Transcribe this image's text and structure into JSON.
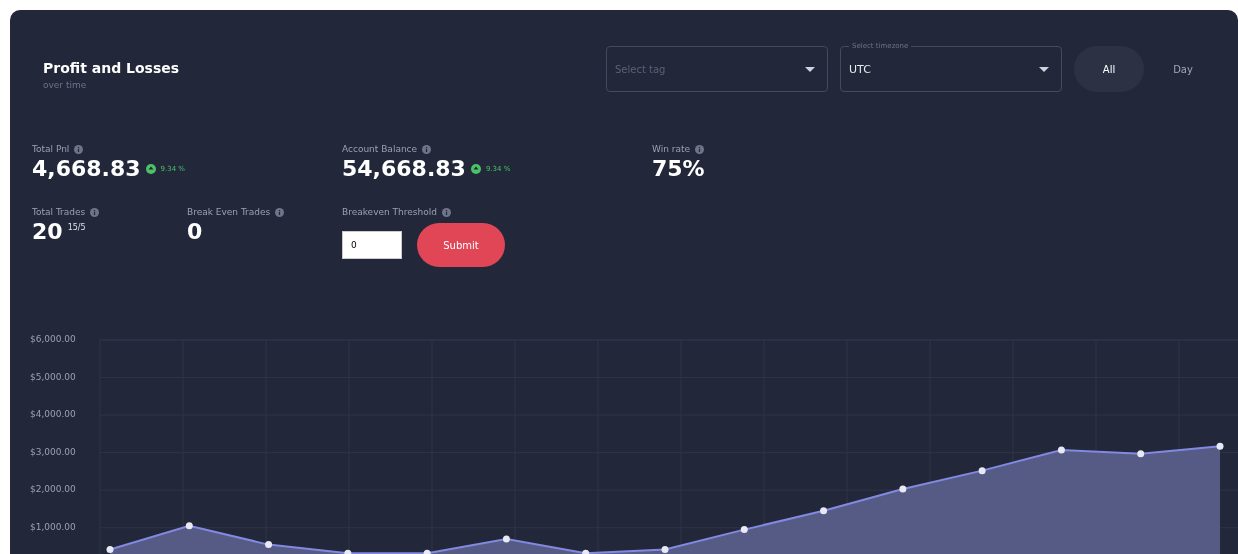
{
  "header": {
    "title": "Profit and Losses",
    "subtitle": "over time"
  },
  "tag_select": {
    "placeholder": "Select tag"
  },
  "timezone_select": {
    "label": "Select timezone",
    "value": "UTC"
  },
  "range_tabs": [
    {
      "label": "All",
      "selected": true
    },
    {
      "label": "Day",
      "selected": false
    }
  ],
  "stats": [
    {
      "label": "Total Pnl",
      "value": "4,668.83",
      "change": "9.34 %"
    },
    {
      "label": "Account Balance",
      "value": "54,668.83",
      "change": "9.34 %"
    },
    {
      "label": "Win rate",
      "value": "75%"
    }
  ],
  "trades": [
    {
      "label": "Total Trades",
      "value": "20",
      "sub": "15/5"
    },
    {
      "label": "Break Even Trades",
      "value": "0"
    }
  ],
  "threshold": {
    "label": "Breakeven Threshold",
    "value": "0",
    "button": "Submit"
  },
  "chart": {
    "chart_data": {
      "type": "area",
      "grid": true,
      "ylim": [
        300,
        6000
      ],
      "yticks": [
        {
          "value": 1000,
          "label": "$1,000.00"
        },
        {
          "value": 2000,
          "label": "$2,000.00"
        },
        {
          "value": 3000,
          "label": "$3,000.00"
        },
        {
          "value": 4000,
          "label": "$4,000.00"
        },
        {
          "value": 5000,
          "label": "$5,000.00"
        },
        {
          "value": 6000,
          "label": "$6,000.00"
        }
      ],
      "series": [
        {
          "color": "#565b85",
          "values": [
            420,
            1050,
            550,
            320,
            320,
            700,
            320,
            420,
            950,
            1450,
            2030,
            2520,
            3070,
            2970,
            3170
          ]
        }
      ]
    }
  }
}
